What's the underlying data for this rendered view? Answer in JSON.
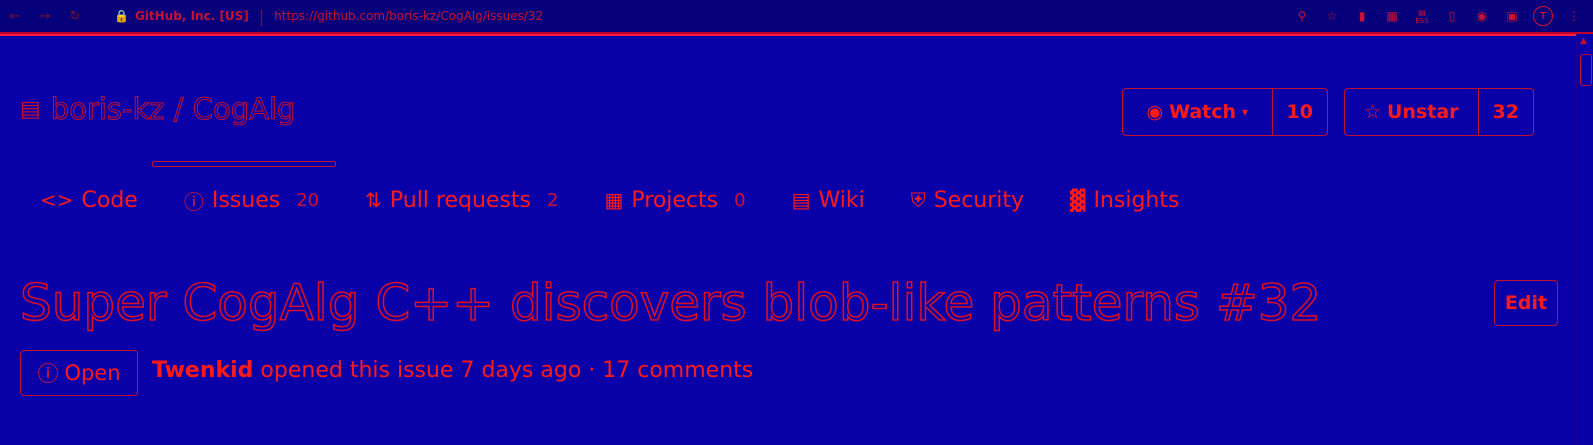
{
  "browser": {
    "back_icon": "arrow-left-icon",
    "forward_icon": "arrow-right-icon",
    "reload_icon": "reload-icon",
    "lock_icon": "lock-icon",
    "site_identity": "GitHub, Inc. [US]",
    "url": "https://github.com/boris-kz/CogAlg/issues/32",
    "extensions": [
      "zoom-icon",
      "star-icon",
      "ext-a-icon",
      "ext-b-icon",
      "ext-c-icon",
      "ext-d-icon",
      "ext-e-icon",
      "ext-f-icon"
    ],
    "ext_badge": "ESS",
    "profile_initial": "T",
    "menu_icon": "kebab-menu-icon"
  },
  "repo": {
    "icon": "repo-icon",
    "full_name": "boris-kz / CogAlg"
  },
  "actions": {
    "watch": {
      "label": "Watch",
      "count": "10"
    },
    "star": {
      "label": "Unstar",
      "count": "32"
    }
  },
  "tabs": [
    {
      "label": "Code",
      "count": ""
    },
    {
      "label": "Issues",
      "count": "20"
    },
    {
      "label": "Pull requests",
      "count": "2"
    },
    {
      "label": "Projects",
      "count": "0"
    },
    {
      "label": "Wiki",
      "count": ""
    },
    {
      "label": "Security",
      "count": ""
    },
    {
      "label": "Insights",
      "count": ""
    }
  ],
  "issue": {
    "title": "Super CogAlg C++ discovers blob-like patterns #32",
    "edit_label": "Edit",
    "state": "Open",
    "author": "Twenkid",
    "meta_text": "opened this issue 7 days ago · 17 comments"
  },
  "colors": {
    "background": "#0a00a8",
    "accent": "#ff1a1a",
    "outline": "#c01030"
  }
}
